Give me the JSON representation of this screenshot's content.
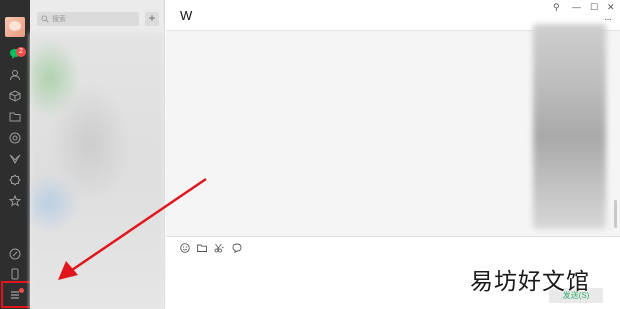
{
  "nav": {
    "badge_count": "2",
    "icons": [
      "chat-icon",
      "contacts-icon",
      "favorites-icon",
      "files-icon",
      "moments-icon",
      "channels-icon",
      "search-icon",
      "mini-programs-icon",
      "phone-icon",
      "more-menu-icon"
    ],
    "accent_color": "#07c160",
    "highlight_color": "#e0161d"
  },
  "list": {
    "search_placeholder": "搜索",
    "add_label": "+"
  },
  "chat": {
    "title": "W",
    "window_controls": [
      "⚲",
      "—",
      "☐",
      "✕"
    ],
    "more_label": "···",
    "tools": [
      "emoji-icon",
      "folder-icon",
      "scissors-icon",
      "chat-history-icon"
    ],
    "send_label": "发送(S)"
  },
  "watermark": "易坊好文馆"
}
